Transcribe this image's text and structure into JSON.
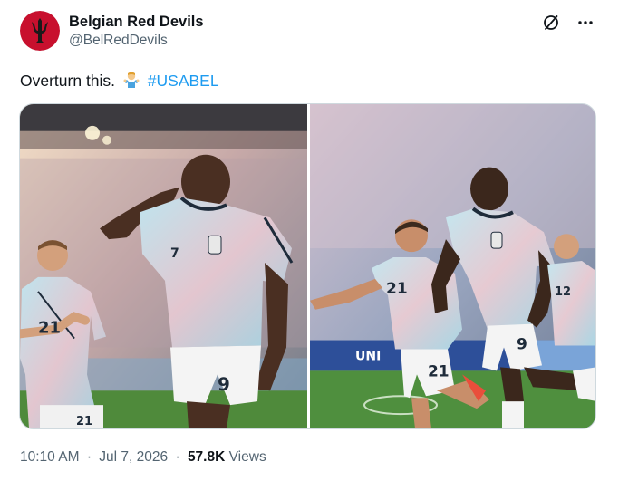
{
  "tweet": {
    "author_name": "Belgian Red Devils",
    "author_handle": "@BelRedDevils",
    "text": "Overturn this.",
    "emoji_icon": "man-shrugging-emoji",
    "hashtag": "#USABEL",
    "time": "10:10 AM",
    "date": "Jul 7, 2026",
    "separator": "·",
    "views_count": "57.8K",
    "views_label": "Views"
  },
  "colors": {
    "link": "#1d9bf0",
    "secondary_text": "#536471",
    "avatar_red": "#c8102e"
  }
}
